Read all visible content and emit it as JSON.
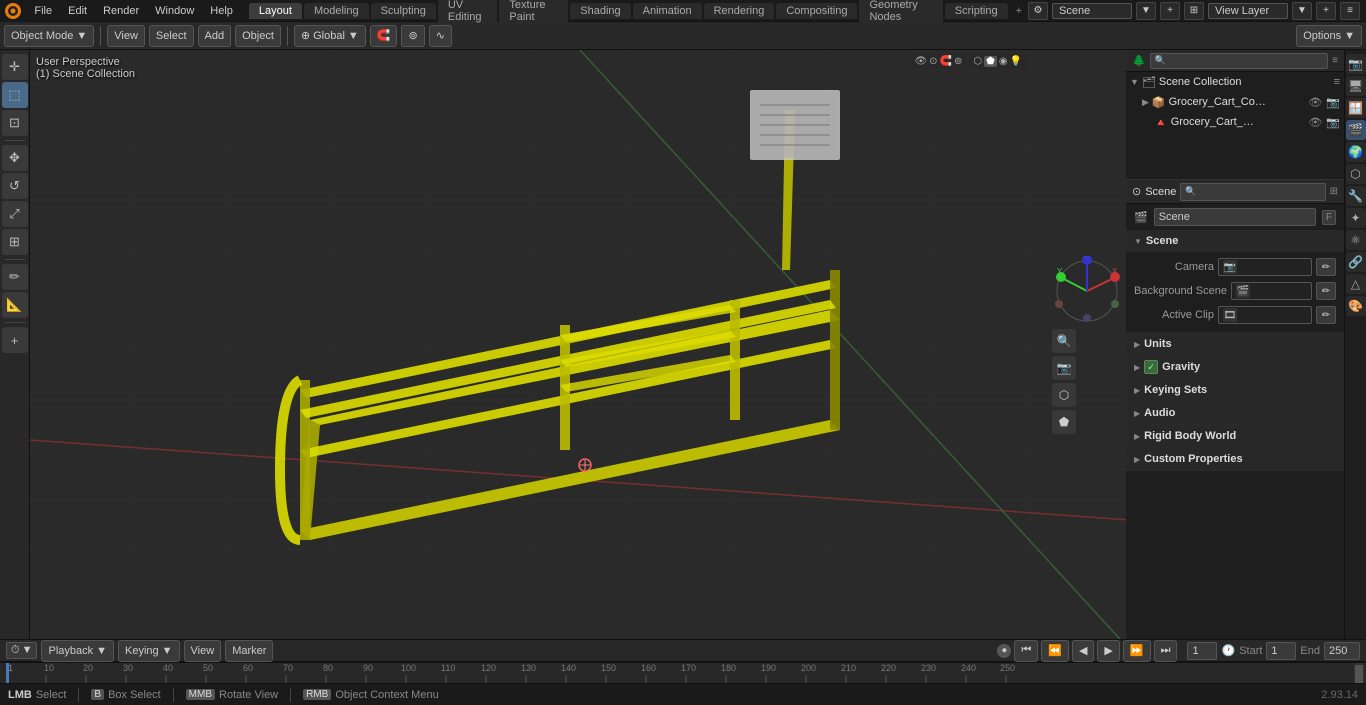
{
  "window": {
    "title": "Blender",
    "version": "2.93.14"
  },
  "top_menu": {
    "items": [
      "File",
      "Edit",
      "Render",
      "Window",
      "Help"
    ],
    "workspace_tabs": [
      "Layout",
      "Modeling",
      "Sculpting",
      "UV Editing",
      "Texture Paint",
      "Shading",
      "Animation",
      "Rendering",
      "Compositing",
      "Geometry Nodes",
      "Scripting"
    ],
    "active_workspace": "Layout",
    "scene_name": "Scene",
    "view_layer": "View Layer"
  },
  "header": {
    "mode": "Object Mode",
    "view_label": "View",
    "select_label": "Select",
    "add_label": "Add",
    "object_label": "Object",
    "transform_global": "Global",
    "options_label": "Options"
  },
  "left_tools": {
    "items": [
      "cursor",
      "move",
      "rotate",
      "scale",
      "transform",
      "annotate",
      "measure",
      "add"
    ]
  },
  "viewport": {
    "view_label": "User Perspective",
    "collection_label": "(1) Scene Collection"
  },
  "outliner": {
    "title": "Scene Collection",
    "search_placeholder": "🔍",
    "items": [
      {
        "name": "Grocery_Cart_Corral_Single_Y",
        "depth": 1,
        "has_children": true,
        "visible": true,
        "selected": false
      },
      {
        "name": "Grocery_Cart_Corral_Sinc",
        "depth": 2,
        "has_children": false,
        "visible": true,
        "selected": false
      }
    ]
  },
  "properties": {
    "active_tab": "scene",
    "tabs": [
      "render",
      "output",
      "view_layer",
      "scene",
      "world",
      "object",
      "particles",
      "physics",
      "constraints",
      "object_data",
      "material",
      "texture"
    ],
    "scene_header": "Scene",
    "scene_name": "Scene",
    "sections": [
      {
        "id": "scene",
        "title": "Scene",
        "expanded": true,
        "items": [
          {
            "label": "Camera",
            "type": "datablock",
            "value": ""
          },
          {
            "label": "Background Scene",
            "type": "datablock",
            "value": ""
          },
          {
            "label": "Active Clip",
            "type": "datablock",
            "value": ""
          }
        ]
      },
      {
        "id": "units",
        "title": "Units",
        "expanded": false
      },
      {
        "id": "gravity",
        "title": "Gravity",
        "expanded": false,
        "has_checkbox": true,
        "checkbox_checked": true
      },
      {
        "id": "keying_sets",
        "title": "Keying Sets",
        "expanded": false
      },
      {
        "id": "audio",
        "title": "Audio",
        "expanded": false
      },
      {
        "id": "rigid_body_world",
        "title": "Rigid Body World",
        "expanded": false
      },
      {
        "id": "custom_properties",
        "title": "Custom Properties",
        "expanded": false
      }
    ]
  },
  "timeline": {
    "playback_label": "Playback",
    "keying_label": "Keying",
    "view_label": "View",
    "marker_label": "Marker",
    "current_frame": "1",
    "start_label": "Start",
    "start_value": "1",
    "end_label": "End",
    "end_value": "250",
    "tick_marks": [
      "1",
      "10",
      "20",
      "30",
      "40",
      "50",
      "60",
      "70",
      "80",
      "90",
      "100",
      "110",
      "120",
      "130",
      "140",
      "150",
      "160",
      "170",
      "180",
      "190",
      "200",
      "210",
      "220",
      "230",
      "240",
      "250"
    ]
  },
  "status_bar": {
    "select_label": "Select",
    "select_key": "LMB",
    "box_select_label": "Box Select",
    "box_select_key": "B",
    "rotate_label": "Rotate View",
    "rotate_key": "MMB",
    "context_menu_label": "Object Context Menu",
    "context_menu_key": "RMB",
    "version": "2.93.14"
  },
  "colors": {
    "accent_blue": "#1d4070",
    "active_tab": "#4a4a4a",
    "bg_dark": "#1e1e1e",
    "bg_mid": "#282828",
    "bg_light": "#3a3a3a",
    "border": "#555555",
    "text_normal": "#cccccc",
    "text_dim": "#888888",
    "yellow_object": "#dddd00",
    "grid_line": "#383838",
    "grid_line_x": "#8a3030",
    "grid_line_y": "#3a8a3a"
  }
}
